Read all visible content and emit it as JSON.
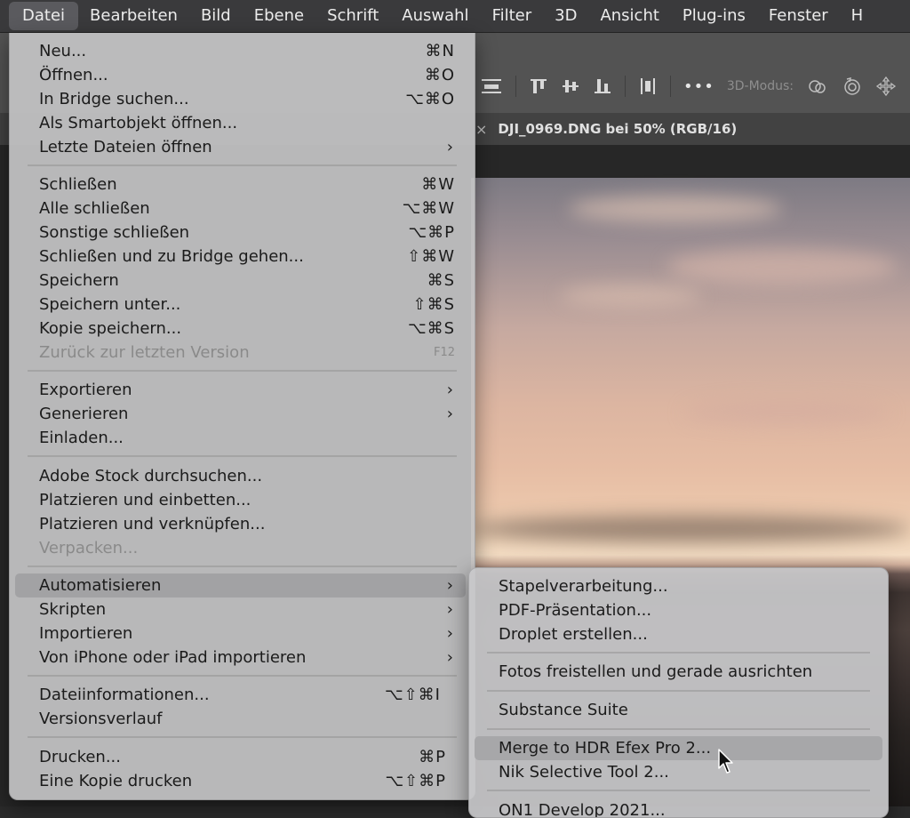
{
  "menubar": {
    "items": [
      "Datei",
      "Bearbeiten",
      "Bild",
      "Ebene",
      "Schrift",
      "Auswahl",
      "Filter",
      "3D",
      "Ansicht",
      "Plug-ins",
      "Fenster",
      "H"
    ]
  },
  "options_bar": {
    "mode_label": "3D-Modus:"
  },
  "document_tab": {
    "close": "×",
    "title": "DJI_0969.DNG bei 50% (RGB/16)"
  },
  "file_menu": {
    "items": [
      {
        "label": "Neu...",
        "shortcut": "⌘N"
      },
      {
        "label": "Öffnen...",
        "shortcut": "⌘O"
      },
      {
        "label": "In Bridge suchen...",
        "shortcut": "⌥⌘O"
      },
      {
        "label": "Als Smartobjekt öffnen...",
        "shortcut": ""
      },
      {
        "label": "Letzte Dateien öffnen",
        "arrow": "›"
      },
      {
        "label": "Schließen",
        "shortcut": "⌘W"
      },
      {
        "label": "Alle schließen",
        "shortcut": "⌥⌘W"
      },
      {
        "label": "Sonstige schließen",
        "shortcut": "⌥⌘P"
      },
      {
        "label": "Schließen und zu Bridge gehen...",
        "shortcut": "⇧⌘W"
      },
      {
        "label": "Speichern",
        "shortcut": "⌘S"
      },
      {
        "label": "Speichern unter...",
        "shortcut": "⇧⌘S"
      },
      {
        "label": "Kopie speichern...",
        "shortcut": "⌥⌘S"
      },
      {
        "label": "Zurück zur letzten Version",
        "shortcut": "F12"
      },
      {
        "label": "Exportieren",
        "arrow": "›"
      },
      {
        "label": "Generieren",
        "arrow": "›"
      },
      {
        "label": "Einladen...",
        "shortcut": ""
      },
      {
        "label": "Adobe Stock durchsuchen...",
        "shortcut": ""
      },
      {
        "label": "Platzieren und einbetten...",
        "shortcut": ""
      },
      {
        "label": "Platzieren und verknüpfen...",
        "shortcut": ""
      },
      {
        "label": "Verpacken...",
        "shortcut": ""
      },
      {
        "label": "Automatisieren",
        "arrow": "›"
      },
      {
        "label": "Skripten",
        "arrow": "›"
      },
      {
        "label": "Importieren",
        "arrow": "›"
      },
      {
        "label": "Von iPhone oder iPad importieren",
        "arrow": "›"
      },
      {
        "label": "Dateiinformationen...",
        "shortcut": "⌥⇧⌘I"
      },
      {
        "label": "Versionsverlauf",
        "shortcut": ""
      },
      {
        "label": "Drucken...",
        "shortcut": "⌘P"
      },
      {
        "label": "Eine Kopie drucken",
        "shortcut": "⌥⇧⌘P"
      }
    ]
  },
  "automate_submenu": {
    "items": [
      "Stapelverarbeitung...",
      "PDF-Präsentation...",
      "Droplet erstellen...",
      "Fotos freistellen und gerade ausrichten",
      "Substance Suite",
      "Merge to HDR Efex Pro 2...",
      "Nik Selective Tool 2...",
      "ON1 Develop 2021..."
    ]
  },
  "colors": {
    "menubar_bg": "#3a3a3c",
    "menu_bg": "#c4c4c6",
    "highlight": "#a0a0a2"
  }
}
